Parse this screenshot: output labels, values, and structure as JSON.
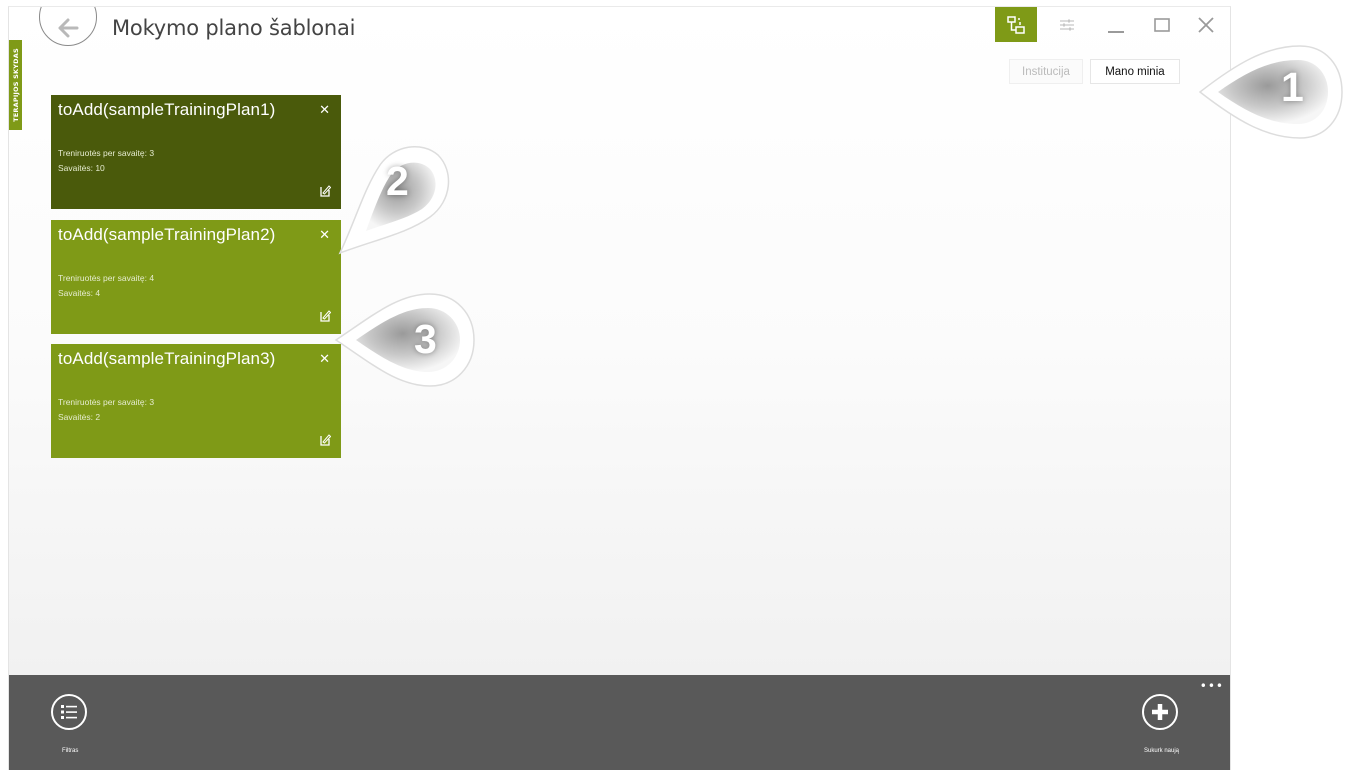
{
  "window": {
    "title": "Mokymo plano šablonai",
    "side_tab": "TERAPIJOS SKYDAS"
  },
  "toolbar": {
    "active_icon": "hierarchy-icon",
    "settings_icon": "sliders-icon",
    "minimize_icon": "minimize-icon",
    "maximize_icon": "maximize-icon",
    "close_icon": "close-icon"
  },
  "filter_toggle": {
    "options": [
      "Institucija",
      "Mano minia"
    ],
    "selected": "Mano minia"
  },
  "plans": [
    {
      "title": "toAdd(sampleTrainingPlan1)",
      "per_week": "Treniruotės per savaitę: 3",
      "weeks": "Savaitės: 10",
      "selected": true
    },
    {
      "title": "toAdd(sampleTrainingPlan2)",
      "per_week": "Treniruotės per savaitę: 4",
      "weeks": "Savaitės: 4",
      "selected": false
    },
    {
      "title": "toAdd(sampleTrainingPlan3)",
      "per_week": "Treniruotės per savaitę: 3",
      "weeks": "Savaitės: 2",
      "selected": false
    }
  ],
  "bottom_bar": {
    "more": "•••",
    "filter_label": "Filtras",
    "create_label": "Sukurk naują"
  },
  "callouts": [
    "1",
    "2",
    "3"
  ],
  "colors": {
    "accent": "#7f9a17",
    "card_selected": "#4a5a0b",
    "card": "#7f9a17",
    "bottom_bar": "#595959"
  }
}
